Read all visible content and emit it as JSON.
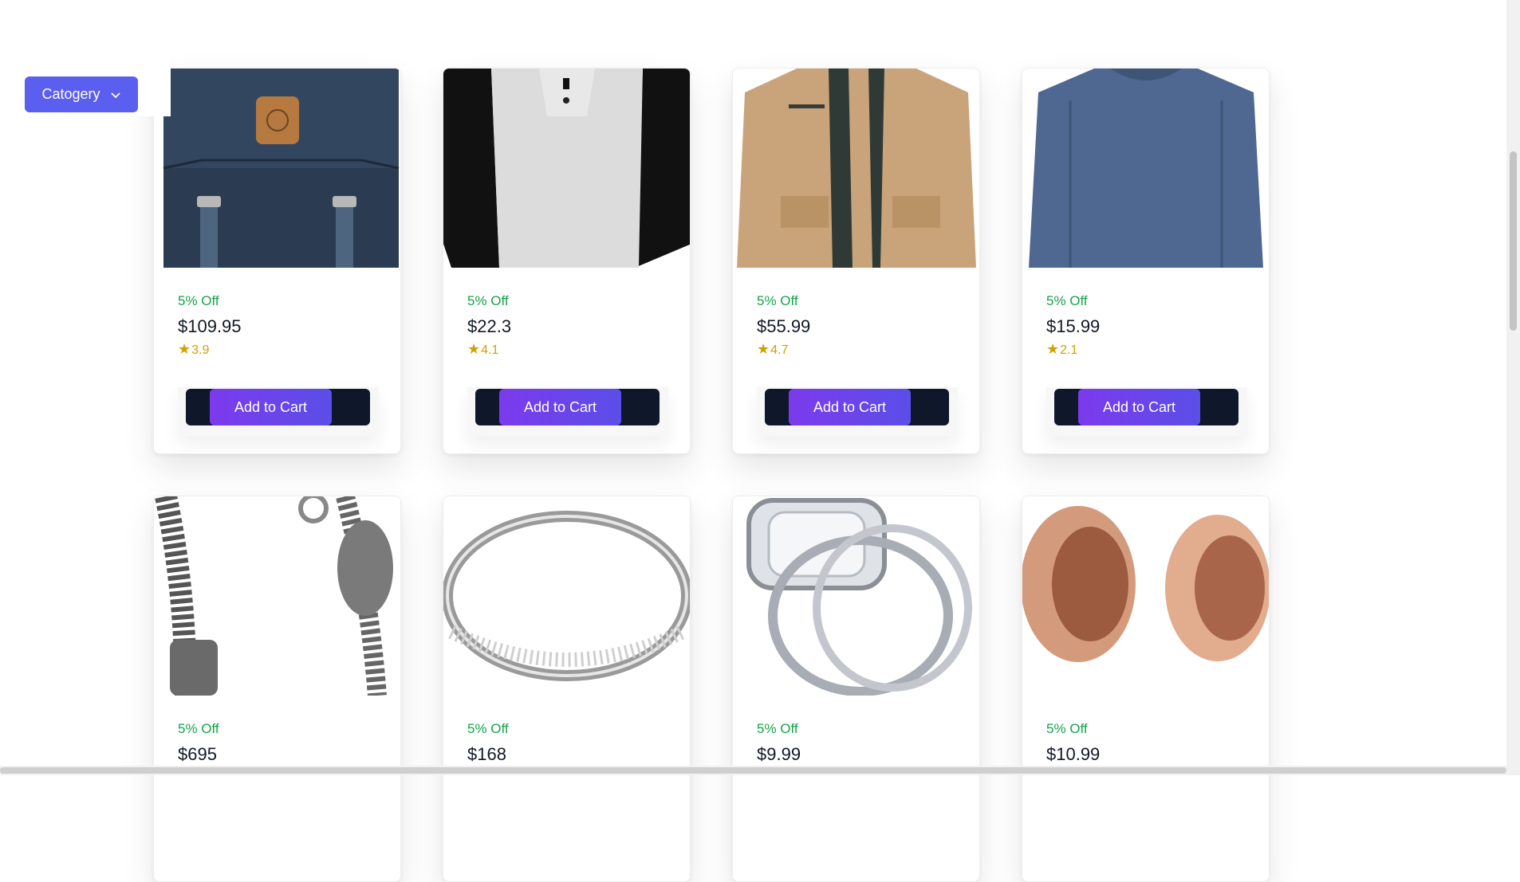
{
  "category_button": {
    "label": "Catogery",
    "icon": "chevron-down-icon"
  },
  "products": [
    {
      "discount": "5% Off",
      "price": "$109.95",
      "rating": "3.9",
      "star": "★",
      "button": "Add to Cart",
      "image": "navy-backpack"
    },
    {
      "discount": "5% Off",
      "price": "$22.3",
      "rating": "4.1",
      "star": "★",
      "button": "Add to Cart",
      "image": "raglan-tshirt"
    },
    {
      "discount": "5% Off",
      "price": "$55.99",
      "rating": "4.7",
      "star": "★",
      "button": "Add to Cart",
      "image": "khaki-jacket"
    },
    {
      "discount": "5% Off",
      "price": "$15.99",
      "rating": "2.1",
      "star": "★",
      "button": "Add to Cart",
      "image": "blue-long-sleeve-shirt"
    },
    {
      "discount": "5% Off",
      "price": "$695",
      "rating": "",
      "star": "",
      "button": "",
      "image": "silver-dragon-bracelet"
    },
    {
      "discount": "5% Off",
      "price": "$168",
      "rating": "",
      "star": "",
      "button": "",
      "image": "diamond-band-ring"
    },
    {
      "discount": "5% Off",
      "price": "$9.99",
      "rating": "",
      "star": "",
      "button": "",
      "image": "halo-engagement-ring"
    },
    {
      "discount": "5% Off",
      "price": "$10.99",
      "rating": "",
      "star": "",
      "button": "",
      "image": "rose-gold-tunnel-plugs"
    }
  ],
  "colors": {
    "accent": "#5b5ff0",
    "discount": "#16a34a",
    "star": "#d4a000",
    "dark": "#0f172a",
    "button": "#7c3aed"
  }
}
